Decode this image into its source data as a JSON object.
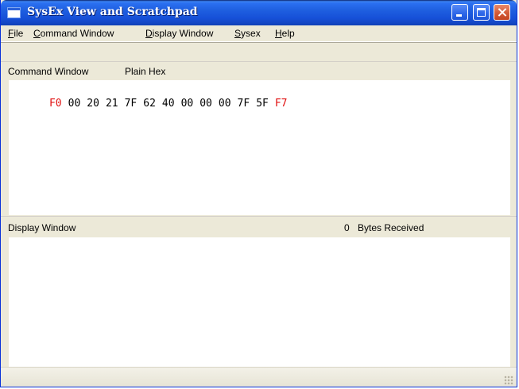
{
  "window": {
    "title": "SysEx View and Scratchpad",
    "controls": {
      "minimize": "minimize-icon",
      "maximize": "maximize-icon",
      "close": "close-icon"
    }
  },
  "menu": {
    "items": [
      {
        "accel": "F",
        "rest": "ile"
      },
      {
        "accel": "C",
        "rest": "ommand Window"
      },
      {
        "accel": "D",
        "rest": "isplay Window"
      },
      {
        "accel": "S",
        "rest": "ysex"
      },
      {
        "accel": "H",
        "rest": "elp"
      }
    ]
  },
  "command_window": {
    "title": "Command Window",
    "mode": "Plain Hex",
    "bytes": [
      "F0",
      "00",
      "20",
      "21",
      "7F",
      "62",
      "40",
      "00",
      "00",
      "00",
      "7F",
      "5F",
      "F7"
    ],
    "delimiter_color": "#e01010"
  },
  "display_window": {
    "title": "Display Window",
    "bytes_received_count": "0",
    "bytes_received_label": "Bytes Received"
  },
  "colors": {
    "titlebar": "#1f5fe0",
    "window_face": "#ece9d8",
    "pane_bg": "#ffffff",
    "close_button": "#d35a36"
  }
}
